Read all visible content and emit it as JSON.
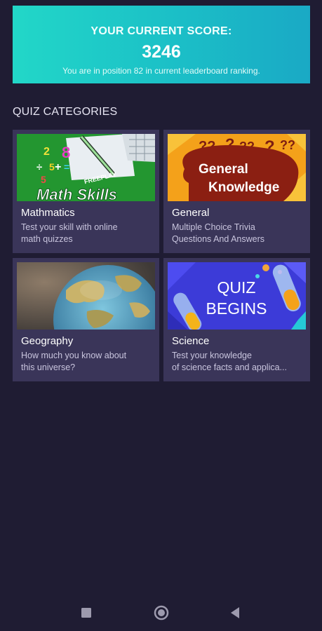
{
  "score": {
    "title": "YOUR CURRENT SCORE:",
    "value": "3246",
    "subtitle": "You are in position 82 in current leaderboard ranking."
  },
  "section_title": "QUIZ CATEGORIES",
  "categories": [
    {
      "name": "Mathmatics",
      "desc_line1": "Test your skill with online",
      "desc_line2": "math quizzes",
      "image_text": "Math Skills",
      "image_badge": "FREEPLAY"
    },
    {
      "name": "General",
      "desc_line1": "Multiple Choice Trivia",
      "desc_line2": "Questions And Answers",
      "image_line1": "General",
      "image_line2": "Knowledge"
    },
    {
      "name": "Geography",
      "desc_line1": "How much you know about",
      "desc_line2": "this universe?"
    },
    {
      "name": "Science",
      "desc_line1": "Test your knowledge",
      "desc_line2": "of science facts and applica...",
      "image_line1": "QUIZ",
      "image_line2": "BEGINS"
    }
  ],
  "colors": {
    "background": "#1f1c33",
    "card": "#3a3559",
    "score_gradient_start": "#22d7c8",
    "score_gradient_end": "#1aa9c5"
  },
  "nav": {
    "recents_icon": "square-icon",
    "home_icon": "circle-icon",
    "back_icon": "triangle-back-icon"
  }
}
